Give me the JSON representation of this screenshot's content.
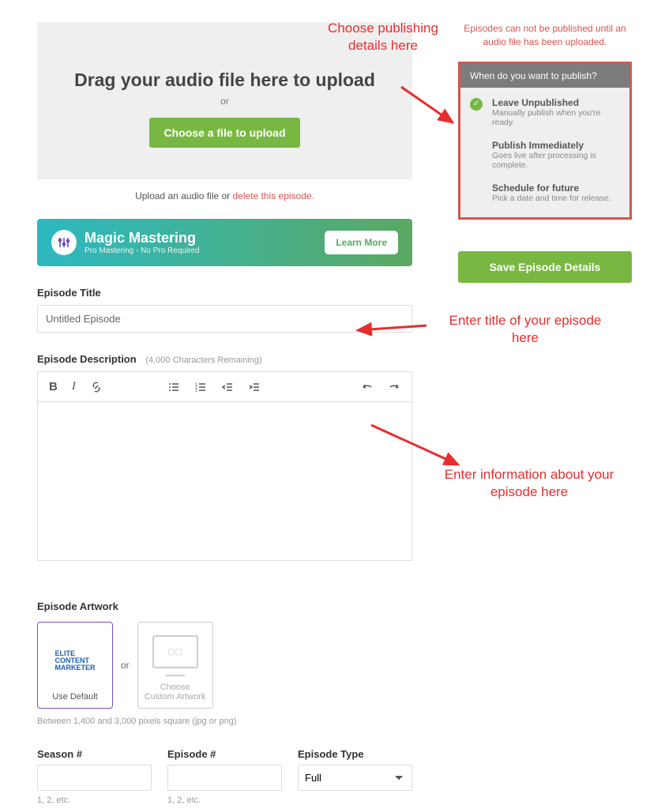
{
  "upload": {
    "title": "Drag your audio file here to upload",
    "or": "or",
    "button": "Choose a file to upload",
    "caption_prefix": "Upload an audio file or ",
    "caption_link": "delete this episode."
  },
  "mastering": {
    "title": "Magic Mastering",
    "subtitle": "Pro Mastering - No Pro Required",
    "button": "Learn More"
  },
  "episode_title": {
    "label": "Episode Title",
    "value": "Untitled Episode"
  },
  "episode_description": {
    "label": "Episode Description",
    "remaining": "(4,000 Characters Remaining)"
  },
  "artwork": {
    "label": "Episode Artwork",
    "default_label": "Use Default",
    "custom_label": "Choose Custom Artwork",
    "or": "or",
    "thumb_text": "ELITE\nCONTENT\nMARKETER",
    "hint": "Between 1,400 and 3,000 pixels square (jpg or png)"
  },
  "season": {
    "label": "Season #",
    "hint": "1, 2, etc."
  },
  "episode_num": {
    "label": "Episode #",
    "hint": "1, 2, etc."
  },
  "episode_type": {
    "label": "Episode Type",
    "value": "Full"
  },
  "sidebar": {
    "warning": "Episodes can not be published until an audio file has been uploaded.",
    "publish_header": "When do you want to publish?",
    "options": [
      {
        "title": "Leave Unpublished",
        "desc": "Manually publish when you're ready.",
        "selected": true
      },
      {
        "title": "Publish Immediately",
        "desc": "Goes live after processing is complete.",
        "selected": false
      },
      {
        "title": "Schedule for future",
        "desc": "Pick a date and time for release.",
        "selected": false
      }
    ],
    "save_button": "Save Episode Details"
  },
  "annotations": {
    "a1": "Choose publishing details here",
    "a2": "Enter title of your episode here",
    "a3": "Enter information about your episode here"
  }
}
